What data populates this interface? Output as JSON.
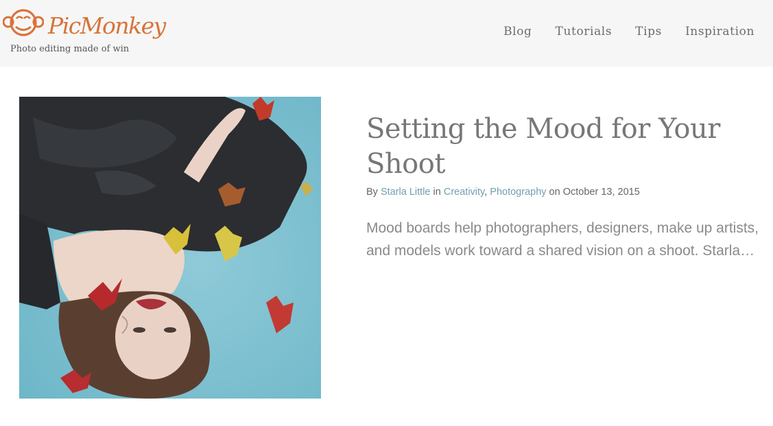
{
  "brand": {
    "name": "PicMonkey",
    "tagline": "Photo editing made of win",
    "color": "#d9733a"
  },
  "nav": {
    "items": [
      {
        "label": "Blog"
      },
      {
        "label": "Tutorials"
      },
      {
        "label": "Tips"
      },
      {
        "label": "Inspiration"
      }
    ]
  },
  "post": {
    "title": "Setting the Mood for Your Shoot",
    "byline_by": "By",
    "author": "Starla Little",
    "byline_in": "in",
    "category1": "Creativity",
    "separator": ",",
    "category2": "Photography",
    "byline_on": "on",
    "date": "October 13, 2015",
    "excerpt_line1": "Mood boards help photographers, designers, make up artists,",
    "excerpt_line2": "and models work toward a shared vision on a shoot. Starla…",
    "link_color": "#6fa0b0"
  }
}
